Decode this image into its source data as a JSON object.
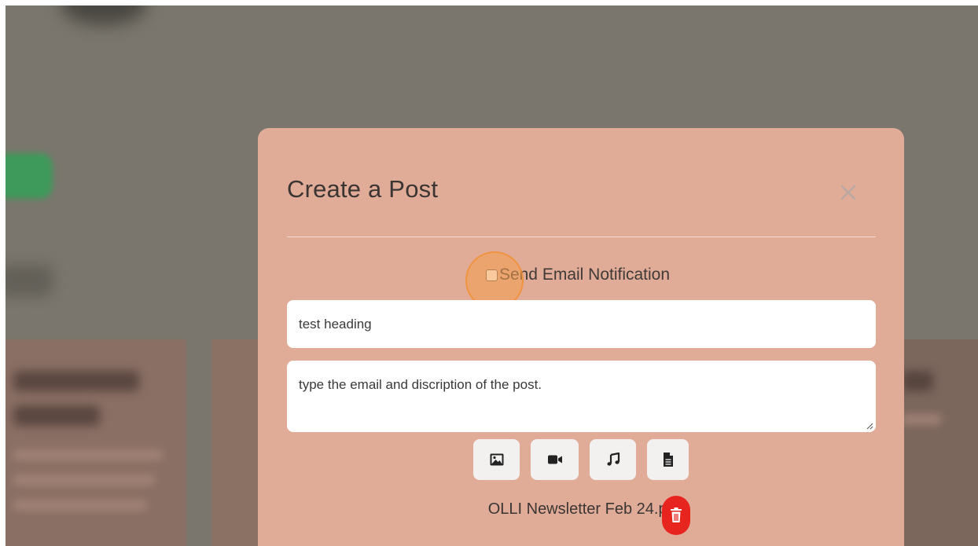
{
  "modal": {
    "title": "Create a Post",
    "close_icon": "close-icon",
    "notify_label": "Send Email Notification",
    "notify_checked": false,
    "heading_value": "test heading",
    "description_value": "type the email and discription of the post.",
    "media_buttons": [
      {
        "icon": "image-icon"
      },
      {
        "icon": "video-icon"
      },
      {
        "icon": "music-icon"
      },
      {
        "icon": "document-icon"
      }
    ],
    "attachment_name": "OLLI Newsletter Feb 24.pdf",
    "attachment_remove_icon": "trash-icon"
  },
  "colors": {
    "modal_bg": "#e0ac98",
    "overlay": "#7a766d",
    "delete_red": "#e8241f",
    "click_highlight": "#f69e4e"
  }
}
